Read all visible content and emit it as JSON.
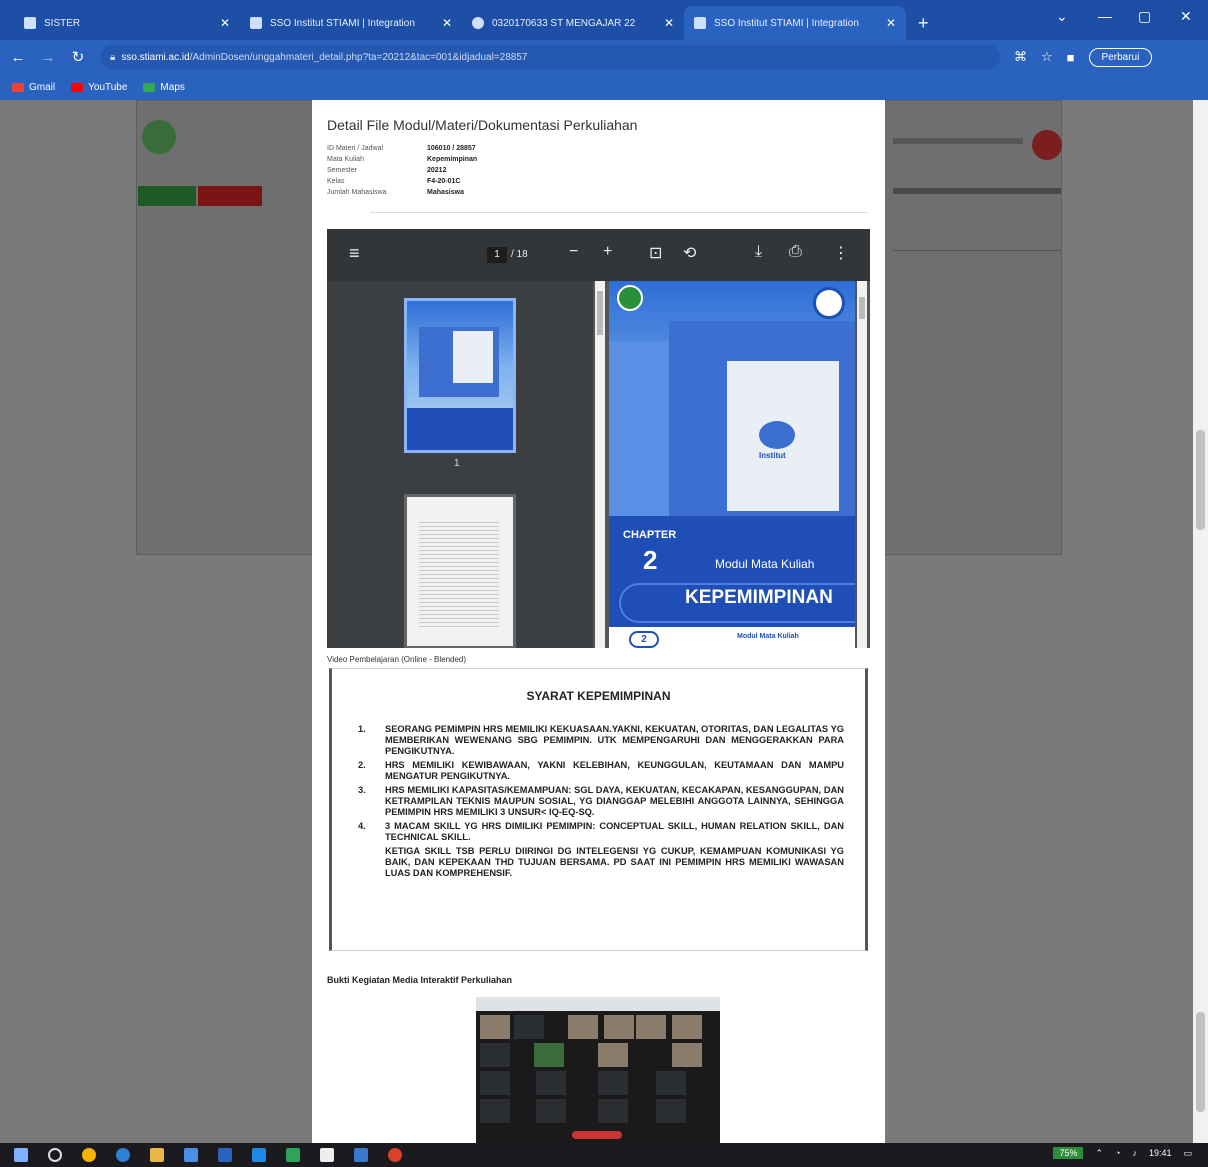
{
  "browser": {
    "tabs": [
      {
        "label": "SISTER"
      },
      {
        "label": "SSO Institut STIAMI | Integration"
      },
      {
        "label": "0320170633 ST MENGAJAR 22"
      },
      {
        "label": "SSO Institut STIAMI | Integration"
      }
    ],
    "active_tab": 3,
    "url_host": "sso.stiami.ac.id",
    "url_path": "/AdminDosen/unggahmateri_detail.php?ta=20212&tac=001&idjadual=28857",
    "update_button": "Perbarui",
    "bookmarks": [
      "Gmail",
      "YouTube",
      "Maps"
    ]
  },
  "modal": {
    "title": "Detail File Modul/Materi/Dokumentasi Perkuliahan",
    "meta": [
      {
        "key": "ID Materi / Jadwal",
        "value": "106010 / 28857"
      },
      {
        "key": "Mata Kuliah",
        "value": "Kepemimpinan"
      },
      {
        "key": "Semester",
        "value": "20212"
      },
      {
        "key": "Kelas",
        "value": "F4-20-01C"
      },
      {
        "key": "Jumlah Mahasiswa",
        "value": "Mahasiswa"
      }
    ]
  },
  "pdf_viewer": {
    "current_page": "1",
    "total_pages": "/ 18",
    "thumbnails": [
      "1"
    ],
    "cover": {
      "chapter_label": "CHAPTER",
      "chapter_number": "2",
      "subtitle": "Modul Mata Kuliah",
      "title": "KEPEMIMPINAN",
      "logo_text": "Institut",
      "next_page_number": "2",
      "next_page_subtitle": "Modul Mata Kuliah"
    }
  },
  "video": {
    "label": "Video Pembelajaran (Online - Blended)",
    "title": "SYARAT KEPEMIMPINAN",
    "items": [
      {
        "n": "1.",
        "text": "SEORANG PEMIMPIN HRS MEMILIKI KEKUASAAN.YAKNI, KEKUATAN, OTORITAS, DAN LEGALITAS YG MEMBERIKAN WEWENANG SBG PEMIMPIN. UTK MEMPENGARUHI DAN MENGGERAKKAN PARA PENGIKUTNYA."
      },
      {
        "n": "2.",
        "text": "HRS MEMILIKI KEWIBAWAAN, YAKNI KELEBIHAN, KEUNGGULAN, KEUTAMAAN DAN MAMPU MENGATUR PENGIKUTNYA."
      },
      {
        "n": "3.",
        "text": "HRS MEMILIKI KAPASITAS/KEMAMPUAN: SGL DAYA, KEKUATAN, KECAKAPAN, KESANGGUPAN, DAN KETRAMPILAN TEKNIS MAUPUN SOSIAL, YG DIANGGAP MELEBIHI ANGGOTA LAINNYA, SEHINGGA PEMIMPIN HRS MEMILIKI 3 UNSUR< IQ-EQ-SQ."
      },
      {
        "n": "4.",
        "text": "3 MACAM SKILL YG HRS DIMILIKI PEMIMPIN: CONCEPTUAL SKILL, HUMAN RELATION SKILL, DAN TECHNICAL SKILL."
      }
    ],
    "note": "KETIGA SKILL TSB PERLU DIIRINGI DG INTELEGENSI YG CUKUP, KEMAMPUAN KOMUNIKASI YG BAIK, DAN KEPEKAAN THD TUJUAN BERSAMA. PD SAAT INI PEMIMPIN HRS MEMILIKI WAWASAN LUAS DAN KOMPREHENSIF."
  },
  "bukti": {
    "label": "Bukti Kegiatan Media Interaktif Perkuliahan"
  },
  "taskbar": {
    "battery": "75%",
    "clock": "19:41"
  },
  "colors": {
    "chrome": "#2a62c0",
    "cover_blue": "#1f4fb6",
    "pdf_toolbar": "#323639"
  }
}
